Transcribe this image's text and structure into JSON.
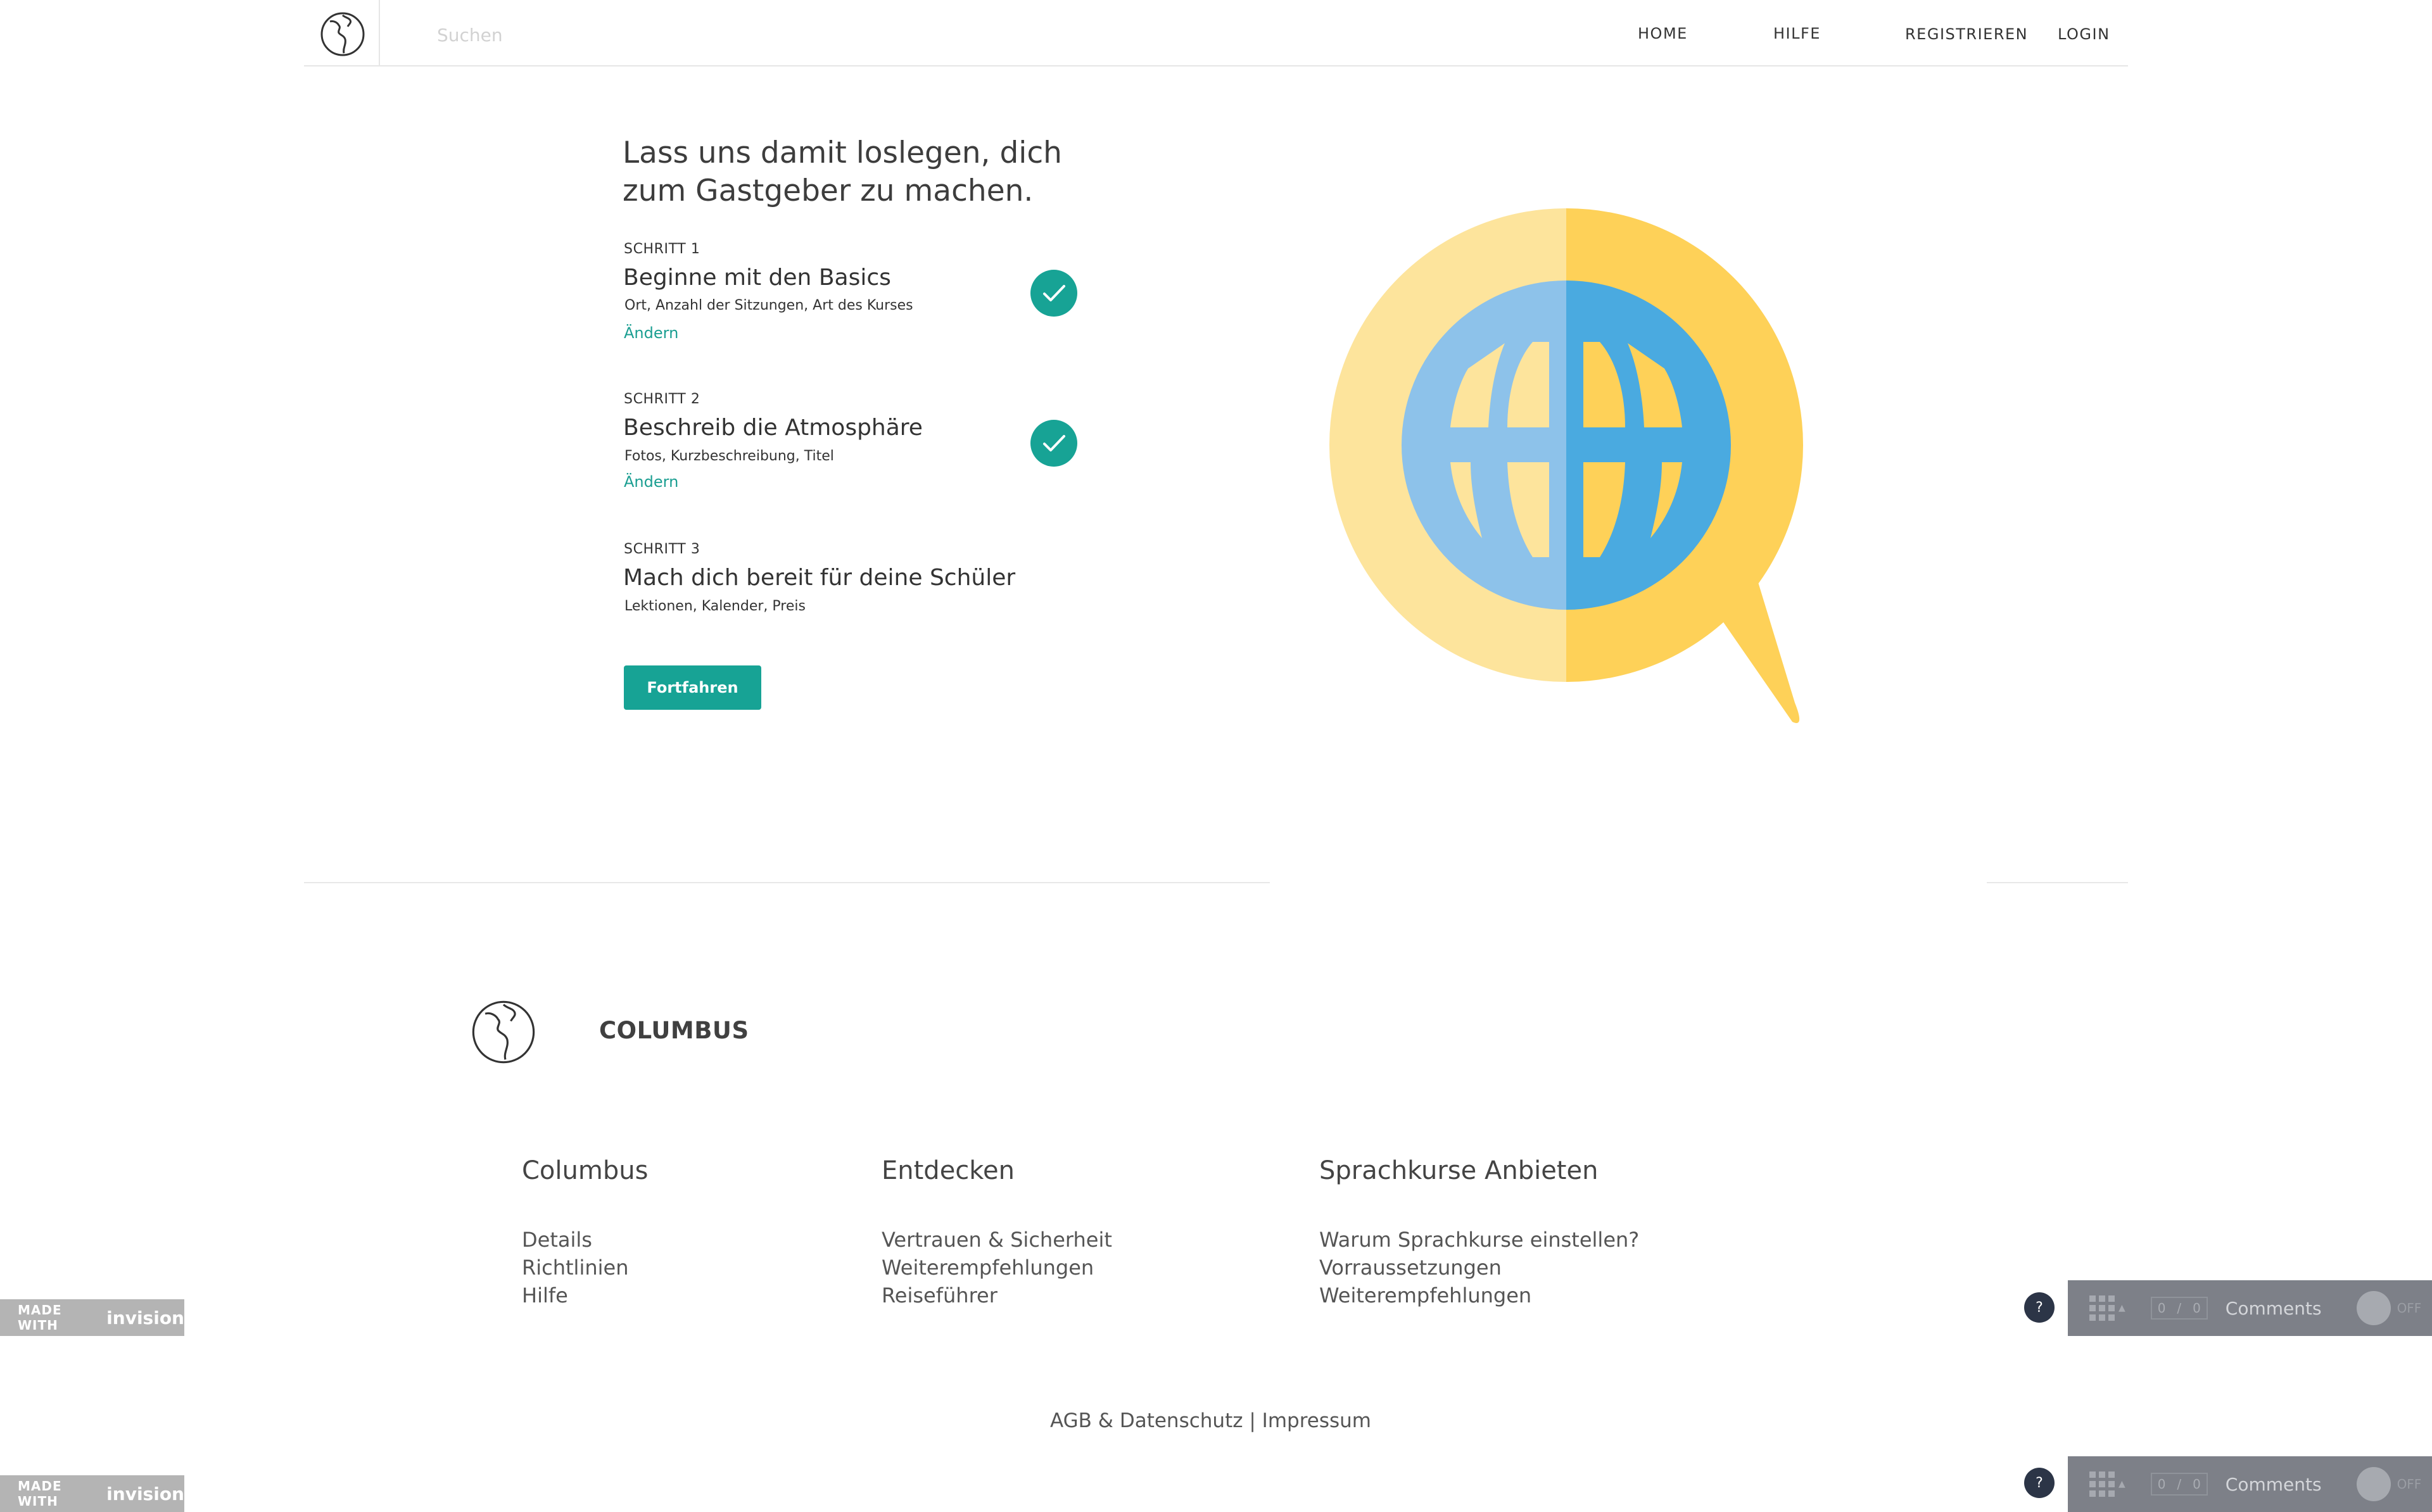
{
  "header": {
    "search_placeholder": "Suchen",
    "nav": {
      "home": "HOME",
      "help": "HILFE",
      "register": "REGISTRIEREN",
      "login": "LOGIN"
    }
  },
  "hero": {
    "title_line1": "Lass uns damit loslegen, dich",
    "title_line2": "zum Gastgeber zu machen.",
    "steps": [
      {
        "label": "SCHRITT 1",
        "title": "Beginne mit den Basics",
        "subtitle": "Ort, Anzahl der Sitzungen, Art des Kurses",
        "edit": "Ändern",
        "completed": true
      },
      {
        "label": "SCHRITT 2",
        "title": "Beschreib die Atmosphäre",
        "subtitle": "Fotos, Kurzbeschreibung, Titel",
        "edit": "Ändern",
        "completed": true
      },
      {
        "label": "SCHRITT 3",
        "title": "Mach dich bereit für deine Schüler",
        "subtitle": "Lektionen, Kalender, Preis",
        "completed": false
      }
    ],
    "cta": "Fortfahren"
  },
  "footer": {
    "brand": "COLUMBUS",
    "columns": [
      {
        "heading": "Columbus",
        "links": [
          "Details",
          "Richtlinien",
          "Hilfe"
        ]
      },
      {
        "heading": "Entdecken",
        "links": [
          "Vertrauen & Sicherheit",
          "Weiterempfehlungen",
          "Reiseführer"
        ]
      },
      {
        "heading": "Sprachkurse Anbieten",
        "links": [
          "Warum Sprachkurse einstellen?",
          "Vorraussetzungen",
          "Weiterempfehlungen"
        ]
      }
    ],
    "legal": {
      "agb": "AGB & Datenschutz",
      "sep": "|",
      "impressum": "Impressum"
    }
  },
  "overlay": {
    "made_with": "MADE WITH",
    "invision": "invision",
    "help": "?",
    "counter_a": "0",
    "counter_sep": "/",
    "counter_b": "0",
    "comments": "Comments",
    "toggle_state": "OFF"
  },
  "colors": {
    "accent": "#17a395",
    "bubble_light": "#fde49c",
    "bubble_dark": "#fed158",
    "globe_light": "#8dc2ea",
    "globe_dark": "#4aaae0"
  },
  "icons": [
    "globe-logo-icon",
    "checkmark-icon",
    "speech-bubble-globe-icon",
    "grid-icon",
    "help-icon"
  ]
}
